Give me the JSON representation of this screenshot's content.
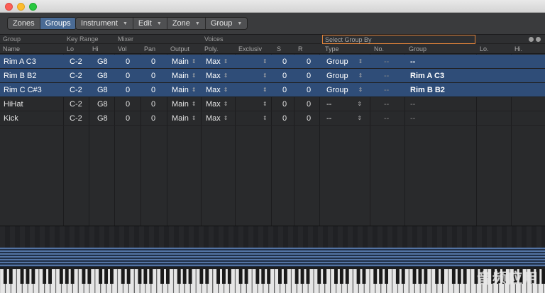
{
  "toolbar": {
    "view_tabs": [
      {
        "label": "Zones",
        "active": false
      },
      {
        "label": "Groups",
        "active": true
      }
    ],
    "menus": [
      "Instrument",
      "Edit",
      "Zone",
      "Group"
    ]
  },
  "header": {
    "sections": {
      "group": "Group",
      "key_range": "Key Range",
      "mixer": "Mixer",
      "voices": "Voices",
      "select_group_by": "Select Group By"
    },
    "columns": {
      "name": "Name",
      "lo": "Lo",
      "hi": "Hi",
      "vol": "Vol",
      "pan": "Pan",
      "output": "Output",
      "poly": "Poly.",
      "exclusive": "Exclusiv",
      "s": "S",
      "r": "R",
      "type": "Type",
      "no": "No.",
      "group": "Group",
      "lo2": "Lo.",
      "hi2": "Hi."
    }
  },
  "rows": [
    {
      "name": "Rim A C3",
      "lo": "C-2",
      "hi": "G8",
      "vol": "0",
      "pan": "0",
      "output": "Main",
      "poly": "Max",
      "s": "0",
      "r": "0",
      "type": "Group",
      "no": "--",
      "group": "--",
      "selected": true
    },
    {
      "name": "Rim B B2",
      "lo": "C-2",
      "hi": "G8",
      "vol": "0",
      "pan": "0",
      "output": "Main",
      "poly": "Max",
      "s": "0",
      "r": "0",
      "type": "Group",
      "no": "--",
      "group": "Rim A C3",
      "selected": true
    },
    {
      "name": "Rim C C#3",
      "lo": "C-2",
      "hi": "G8",
      "vol": "0",
      "pan": "0",
      "output": "Main",
      "poly": "Max",
      "s": "0",
      "r": "0",
      "type": "Group",
      "no": "--",
      "group": "Rim B B2",
      "selected": true
    },
    {
      "name": "HiHat",
      "lo": "C-2",
      "hi": "G8",
      "vol": "0",
      "pan": "0",
      "output": "Main",
      "poly": "Max",
      "s": "0",
      "r": "0",
      "type": "--",
      "no": "--",
      "group": "--",
      "selected": false
    },
    {
      "name": "Kick",
      "lo": "C-2",
      "hi": "G8",
      "vol": "0",
      "pan": "0",
      "output": "Main",
      "poly": "Max",
      "s": "0",
      "r": "0",
      "type": "--",
      "no": "--",
      "group": "--",
      "selected": false
    }
  ],
  "watermark": "音频应用",
  "colors": {
    "selection": "#2f4d78",
    "accent": "#4a6b95",
    "highlight_border": "#e2833a"
  }
}
